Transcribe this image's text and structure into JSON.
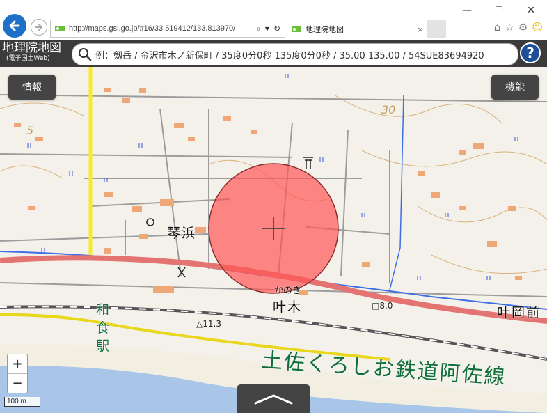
{
  "browser": {
    "url": "http://maps.gsi.go.jp/#16/33.519412/133.813970/",
    "tab_title": "地理院地図",
    "tab_close": "×",
    "window": {
      "minimize": "—",
      "maximize": "☐",
      "close": "✕"
    }
  },
  "header": {
    "logo_main": "地理院地図",
    "logo_sub": "(電子国土Web)",
    "search_placeholder": "例：剱岳 / 金沢市木ノ新保町 / 35度0分0秒 135度0分0秒 / 35.00 135.00 / 54SUE83694920",
    "help_label": "?"
  },
  "map": {
    "info_label": "情報",
    "func_label": "機能",
    "zoom_in": "+",
    "zoom_out": "−",
    "scale_label": "100 m",
    "place_labels": {
      "kotogahama": "琴浜",
      "kanougi": "叶木",
      "kanougi_kana": "かのき",
      "kanooka": "叶岡前",
      "station_line1": "和",
      "station_line2": "食",
      "station_line3": "駅",
      "railway": "土佐くろしお鉄道阿佐線",
      "contour_30": "30",
      "contour_5": "5",
      "height_11": "△11.3",
      "height_8": "□8.0"
    }
  },
  "colors": {
    "header_bg": "#3b3b3b",
    "accent_blue": "#1e6fc8",
    "road_red": "#e47472",
    "road_yellow": "#f7ea2a",
    "water": "#a9c6e8",
    "marker": "#ff5555"
  }
}
